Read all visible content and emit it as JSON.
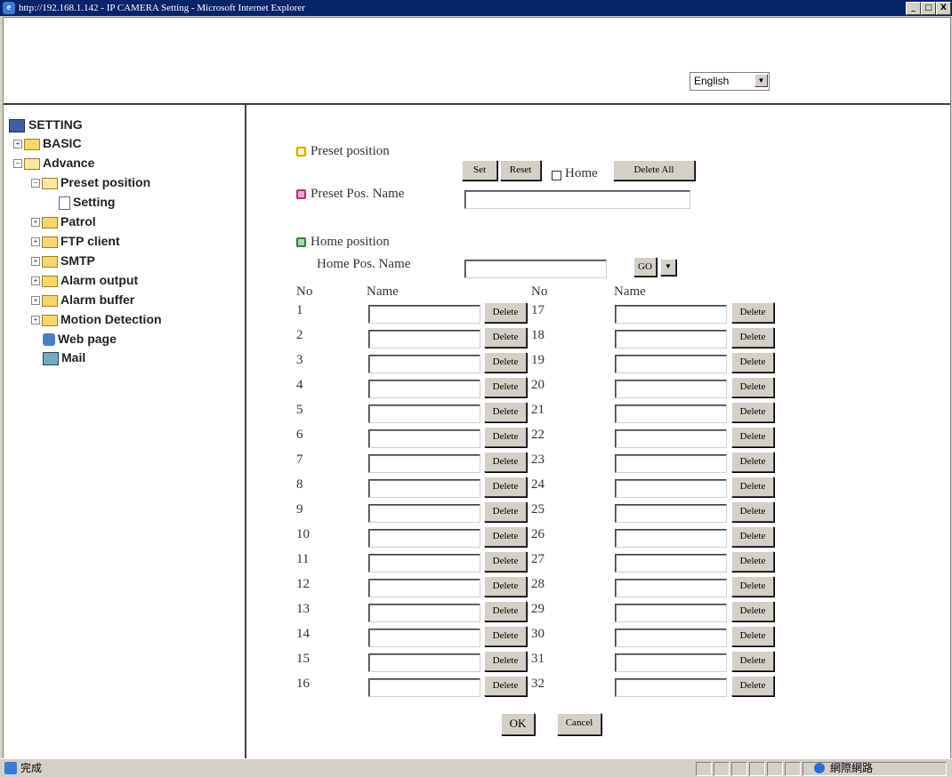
{
  "window": {
    "title": "http://192.168.1.142 - IP CAMERA Setting - Microsoft Internet Explorer",
    "btn_min": "_",
    "btn_max": "□",
    "btn_close": "X"
  },
  "header": {
    "language_value": "English"
  },
  "sidebar": {
    "root": "SETTING",
    "items": [
      {
        "label": "BASIC"
      },
      {
        "label": "Advance"
      },
      {
        "label": "Preset position"
      },
      {
        "label": "Setting"
      },
      {
        "label": "Patrol"
      },
      {
        "label": "FTP client"
      },
      {
        "label": "SMTP"
      },
      {
        "label": "Alarm output"
      },
      {
        "label": "Alarm buffer"
      },
      {
        "label": "Motion Detection"
      },
      {
        "label": "Web page"
      },
      {
        "label": "Mail"
      }
    ]
  },
  "preset": {
    "section_label": "Preset position",
    "set_label": "Set",
    "reset_label": "Reset",
    "home_label": "Home",
    "delete_all_label": "Delete All",
    "name_label": "Preset Pos. Name",
    "name_value": ""
  },
  "home": {
    "section_label": "Home position",
    "name_label": "Home Pos. Name",
    "go_label": "GO"
  },
  "table": {
    "col_no": "No",
    "col_name": "Name",
    "delete_label": "Delete",
    "rows": [
      "1",
      "2",
      "3",
      "4",
      "5",
      "6",
      "7",
      "8",
      "9",
      "10",
      "11",
      "12",
      "13",
      "14",
      "15",
      "16",
      "17",
      "18",
      "19",
      "20",
      "21",
      "22",
      "23",
      "24",
      "25",
      "26",
      "27",
      "28",
      "29",
      "30",
      "31",
      "32"
    ]
  },
  "footer": {
    "ok_label": "OK",
    "cancel_label": "Cancel"
  },
  "status": {
    "left_text": "完成",
    "zone_text": "網際網路"
  }
}
